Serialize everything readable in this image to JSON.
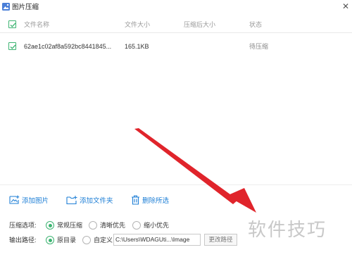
{
  "window": {
    "title": "图片压缩",
    "close_glyph": "✕"
  },
  "table": {
    "columns": [
      "文件名称",
      "文件大小",
      "压缩后大小",
      "状态"
    ],
    "rows": [
      {
        "name": "62ae1c02af8a592bc8441845...",
        "size": "165.1KB",
        "compressed_size": "",
        "status": "待压缩",
        "checked": true
      }
    ]
  },
  "toolbar": {
    "add_image": "添加图片",
    "add_folder": "添加文件夹",
    "delete_selected": "删除所选"
  },
  "compression": {
    "label": "压缩选项:",
    "options": [
      "常规压缩",
      "清晰优先",
      "缩小优先"
    ],
    "selected": "常规压缩"
  },
  "output": {
    "label": "输出路径:",
    "options": [
      "原目录",
      "自定义"
    ],
    "selected": "原目录",
    "path": "C:\\Users\\WDAGUti...\\Image",
    "change_button": "更改路径"
  },
  "watermark": "软件技巧",
  "colors": {
    "accent": "#1e7fd6",
    "check": "#3cb371",
    "arrow": "#e0242b"
  }
}
